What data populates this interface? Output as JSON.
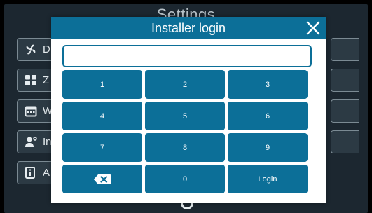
{
  "background": {
    "title": "Settings",
    "menu_items": [
      {
        "icon": "fan-icon",
        "label": "D"
      },
      {
        "icon": "zones-grid-icon",
        "label": "Z"
      },
      {
        "icon": "calendar-icon",
        "label": "W"
      },
      {
        "icon": "installer-user-icon",
        "label": "In"
      },
      {
        "icon": "info-icon",
        "label": "A"
      }
    ]
  },
  "dialog": {
    "title": "Installer login",
    "close_icon": "close-icon",
    "pin_value": "",
    "pin_placeholder": ""
  },
  "keypad": {
    "keys": [
      {
        "label": "1"
      },
      {
        "label": "2"
      },
      {
        "label": "3"
      },
      {
        "label": "4"
      },
      {
        "label": "5"
      },
      {
        "label": "6"
      },
      {
        "label": "7"
      },
      {
        "label": "8"
      },
      {
        "label": "9"
      },
      {
        "label": "",
        "icon": "backspace-icon"
      },
      {
        "label": "0"
      },
      {
        "label": "Login"
      }
    ]
  },
  "colors": {
    "accent": "#0c6f98",
    "background": "#1c2730",
    "text_on_accent": "#ffffff"
  }
}
